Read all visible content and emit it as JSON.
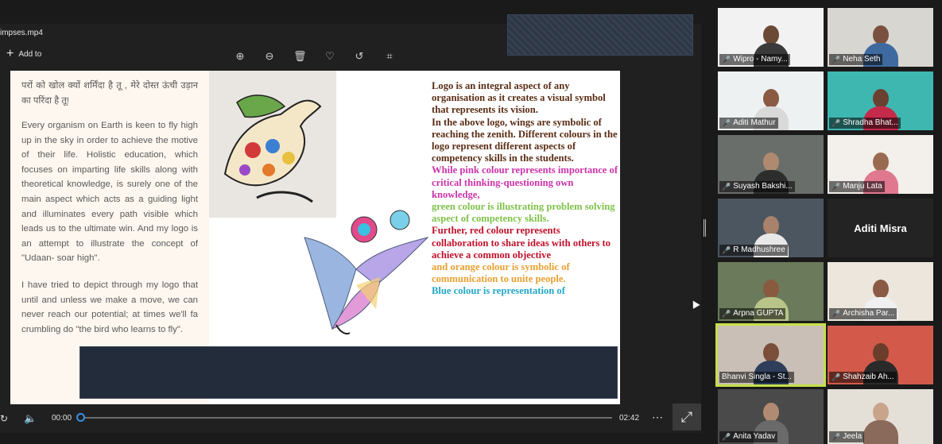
{
  "player": {
    "title": "impses.mp4",
    "add_to_label": "Add to",
    "icons": [
      "zoom-in-icon",
      "zoom-out-icon",
      "delete-icon",
      "heart-icon",
      "rotate-icon",
      "crop-icon"
    ],
    "time_current": "00:00",
    "time_total": "02:42",
    "progress": 0.0
  },
  "slide": {
    "hindi_line": "परों को खोल क्यों शर्मिंदा है तू , मेरे दोस्त ऊंची उड़ान का परिंदा है तू!",
    "para1": "Every organism on Earth is keen to fly high up in the sky in order to achieve the motive of their life. Holistic education, which focuses on imparting life skills along with theoretical knowledge, is surely one of the main aspect which acts as a guiding light and illuminates every path visible which leads us to the ultimate win. And my logo is an attempt to illustrate the concept of \"Udaan- soar high\".",
    "para2": "I have tried to depict through my logo that until and unless we make a move, we can never reach our potential; at times we'll fa crumbling do \"the bird who learns to fly\".",
    "right_intro": "Logo is an integral aspect of any organisation as it creates a visual symbol that represents its vision.",
    "right_wings": "In the above logo, wings are symbolic of reaching the zenith. Different colours in the logo represent different aspects of competency skills in the students.",
    "pink_text": "While pink colour represents importance of critical thinking-questioning own knowledge,",
    "green_text": "green colour is illustrating problem solving aspect of competency skills.",
    "red_text": "Further, red colour represents collaboration to share ideas with others to achieve a common objective",
    "orange_text": "and orange colour is symbolic of communication to unite people.",
    "blue_text": "Blue colour is representation of",
    "colors": {
      "pink": "#cc33aa",
      "green": "#7fc24a",
      "red": "#c0102a",
      "orange": "#e8a030",
      "blue": "#22a8c8",
      "brown": "#5a2d14"
    }
  },
  "participants": [
    {
      "name": "Wipro - Namy...",
      "muted": true
    },
    {
      "name": "Neha Seth",
      "muted": true
    },
    {
      "name": "Aditi Mathur",
      "muted": true
    },
    {
      "name": "Shradha Bhat...",
      "muted": true
    },
    {
      "name": "Suyash Bakshi...",
      "muted": true
    },
    {
      "name": "Manju Lata",
      "muted": true
    },
    {
      "name": "R Madhushree",
      "muted": true
    },
    {
      "name": "Aditi Misra",
      "muted": false,
      "no_video": true
    },
    {
      "name": "Arpna GUPTA",
      "muted": true
    },
    {
      "name": "Archisha Par...",
      "muted": true
    },
    {
      "name": "Bhanvi Singla - St...",
      "muted": false,
      "active_speaker": true
    },
    {
      "name": "Shahzaib Ah...",
      "muted": true
    },
    {
      "name": "Anita Yadav",
      "muted": true
    },
    {
      "name": "Jeela",
      "muted": true
    }
  ]
}
